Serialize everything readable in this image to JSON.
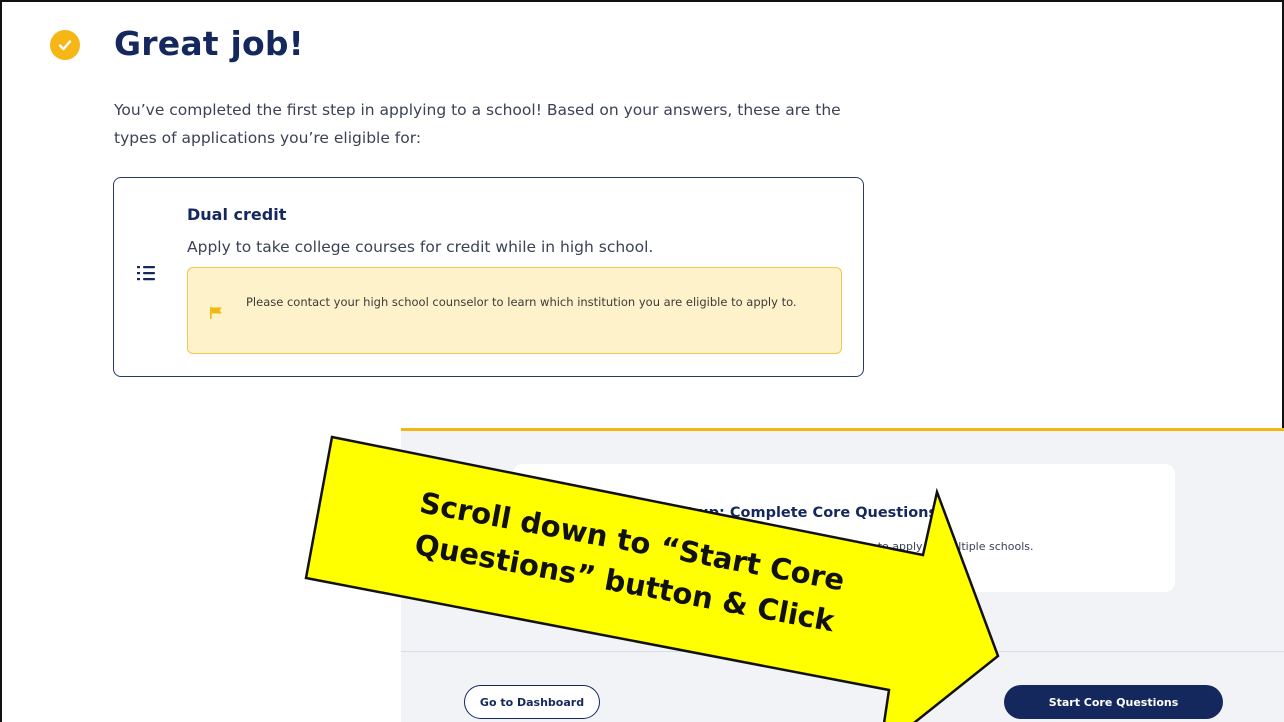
{
  "header": {
    "title": "Great job!",
    "intro": "You’ve completed the first step in applying to a school! Based on your answers, these are the types of applications you’re eligible for:"
  },
  "application_card": {
    "title": "Dual credit",
    "description": "Apply to take college courses for credit while in high school.",
    "notice": "Please contact your high school counselor to learn which institution you are eligible to apply to."
  },
  "next_step": {
    "title": "Next up: Complete Core Questions",
    "description": "a set of common questions you can use to apply to multiple schools."
  },
  "actions": {
    "dashboard_label": "Go to Dashboard",
    "start_label": "Start Core Questions"
  },
  "callout": {
    "text": "Scroll down to “Start Core Questions” button & Click"
  },
  "colors": {
    "brand_navy": "#14285e",
    "accent_yellow": "#f6b716",
    "notice_bg": "#fdf2c9",
    "callout_fill": "#ffff00"
  }
}
